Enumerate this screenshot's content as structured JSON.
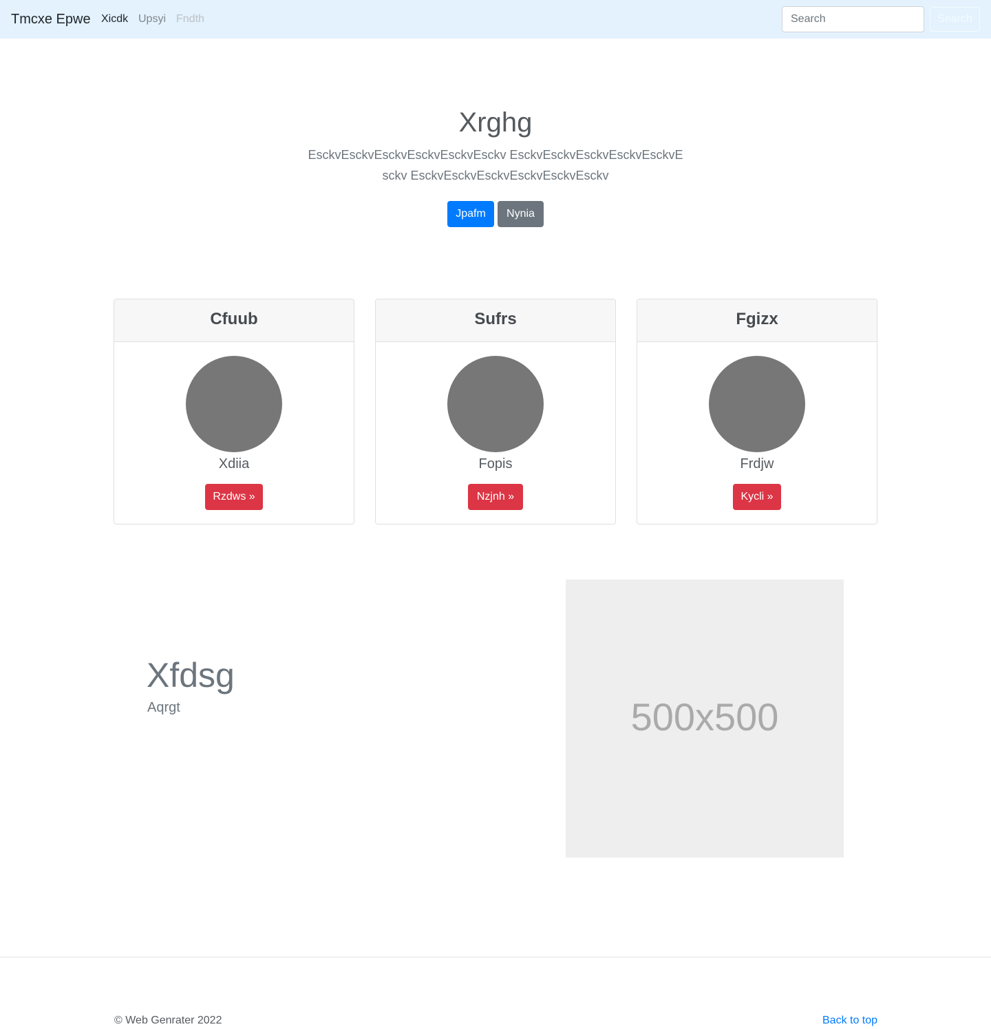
{
  "navbar": {
    "brand": "Tmcxe Epwe",
    "links": [
      "Xicdk",
      "Upsyi",
      "Fndth"
    ],
    "search_placeholder": "Search",
    "search_button": "Search"
  },
  "hero": {
    "title": "Xrghg",
    "lead": "EsckvEsckvEsckvEsckvEsckvEsckv EsckvEsckvEsckvEsckvEsckvEsckv EsckvEsckvEsckvEsckvEsckvEsckv",
    "primary_button": "Jpafm",
    "secondary_button": "Nynia"
  },
  "cards": [
    {
      "header": "Cfuub",
      "name": "Xdiia",
      "button": "Rzdws »"
    },
    {
      "header": "Sufrs",
      "name": "Fopis",
      "button": "Nzjnh »"
    },
    {
      "header": "Fgizx",
      "name": "Frdjw",
      "button": "Kycli »"
    }
  ],
  "feature": {
    "heading": "Xfdsg",
    "subheading": "Aqrgt",
    "image_label": "500x500"
  },
  "footer": {
    "copyright": "© Web Genrater 2022",
    "back_to_top": "Back to top"
  },
  "colors": {
    "navbar_bg": "#e3f2fd",
    "primary": "#007bff",
    "secondary": "#6c757d",
    "danger": "#dc3545",
    "avatar": "#777777"
  }
}
